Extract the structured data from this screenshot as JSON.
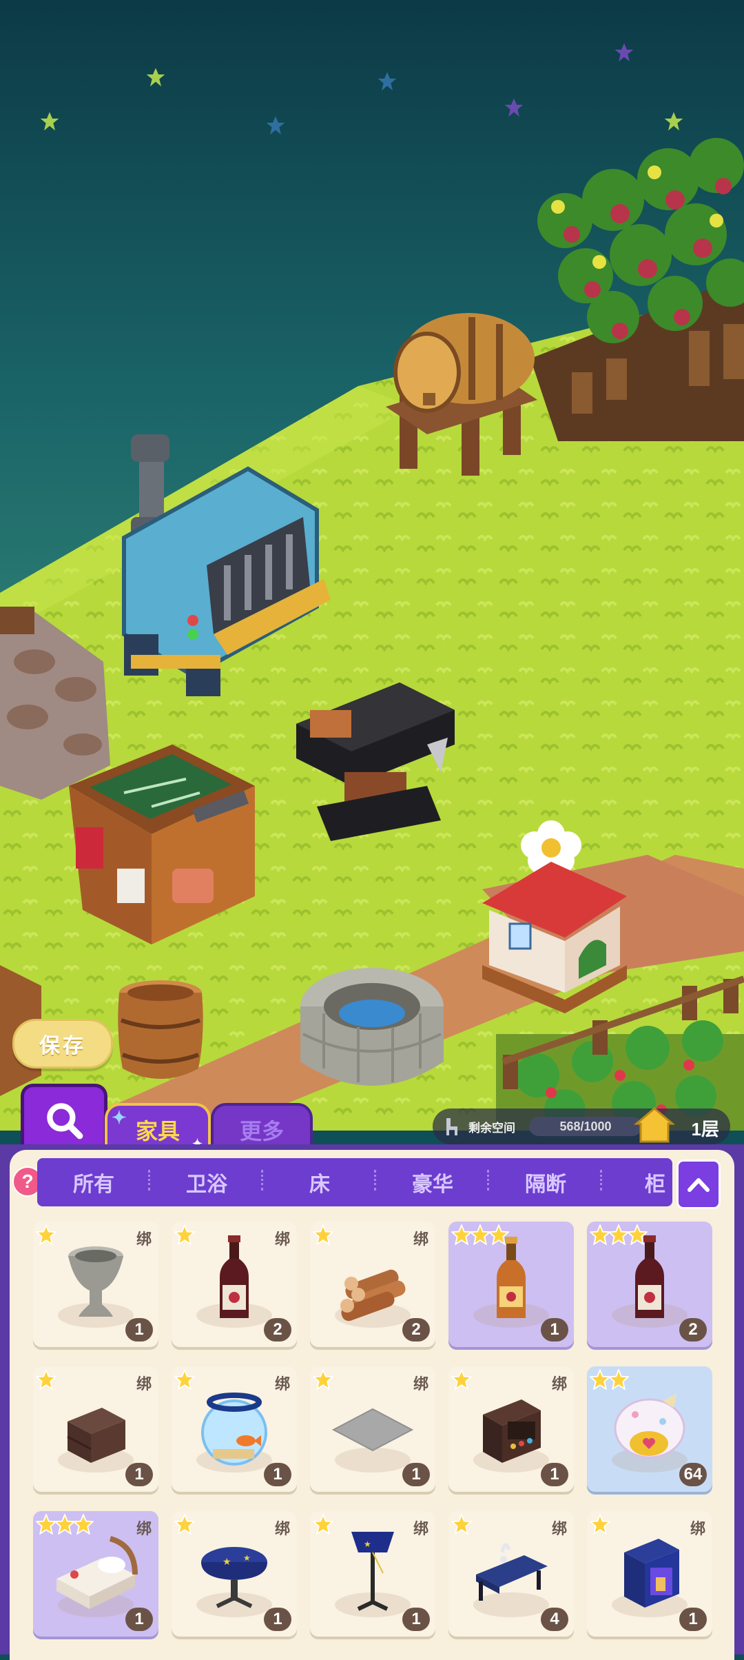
{
  "scene": {
    "save_label": "保存"
  },
  "tabs": {
    "furniture": "家具",
    "more": "更多"
  },
  "status": {
    "space_label": "剩余空间",
    "capacity": "568/1000",
    "floor": "1层"
  },
  "categories": [
    "所有",
    "卫浴",
    "床",
    "豪华",
    "隔断",
    "柜"
  ],
  "help_label": "?",
  "items": [
    {
      "name": "stone-vase",
      "stars": 1,
      "bound": "绑",
      "count": "1",
      "bg": "cream"
    },
    {
      "name": "red-wine-bottle",
      "stars": 1,
      "bound": "绑",
      "count": "2",
      "bg": "cream"
    },
    {
      "name": "firewood-logs",
      "stars": 1,
      "bound": "绑",
      "count": "2",
      "bg": "cream"
    },
    {
      "name": "amber-wine-bottle",
      "stars": 3,
      "bound": "",
      "count": "1",
      "bg": "purple"
    },
    {
      "name": "red-wine-bottle-premium",
      "stars": 3,
      "bound": "",
      "count": "2",
      "bg": "purple"
    },
    {
      "name": "dark-nightstand",
      "stars": 1,
      "bound": "绑",
      "count": "1",
      "bg": "cream"
    },
    {
      "name": "fish-bowl",
      "stars": 1,
      "bound": "绑",
      "count": "1",
      "bg": "cream"
    },
    {
      "name": "gray-rug",
      "stars": 1,
      "bound": "绑",
      "count": "1",
      "bg": "cream"
    },
    {
      "name": "retro-radio-cabinet",
      "stars": 1,
      "bound": "绑",
      "count": "1",
      "bg": "cream"
    },
    {
      "name": "gift-pouch",
      "stars": 2,
      "bound": "",
      "count": "64",
      "bg": "blue"
    },
    {
      "name": "cozy-bed",
      "stars": 3,
      "bound": "绑",
      "count": "1",
      "bg": "purple"
    },
    {
      "name": "star-side-table",
      "stars": 1,
      "bound": "绑",
      "count": "1",
      "bg": "cream"
    },
    {
      "name": "starry-floor-lamp",
      "stars": 1,
      "bound": "绑",
      "count": "1",
      "bg": "cream"
    },
    {
      "name": "blue-bench",
      "stars": 1,
      "bound": "绑",
      "count": "4",
      "bg": "cream"
    },
    {
      "name": "star-cabinet",
      "stars": 1,
      "bound": "绑",
      "count": "1",
      "bg": "cream"
    }
  ],
  "colors": {
    "grass": "#b7d93c",
    "accent_purple": "#6d3dd0",
    "star_gold": "#ffd23a",
    "count_badge": "#6a5346"
  }
}
